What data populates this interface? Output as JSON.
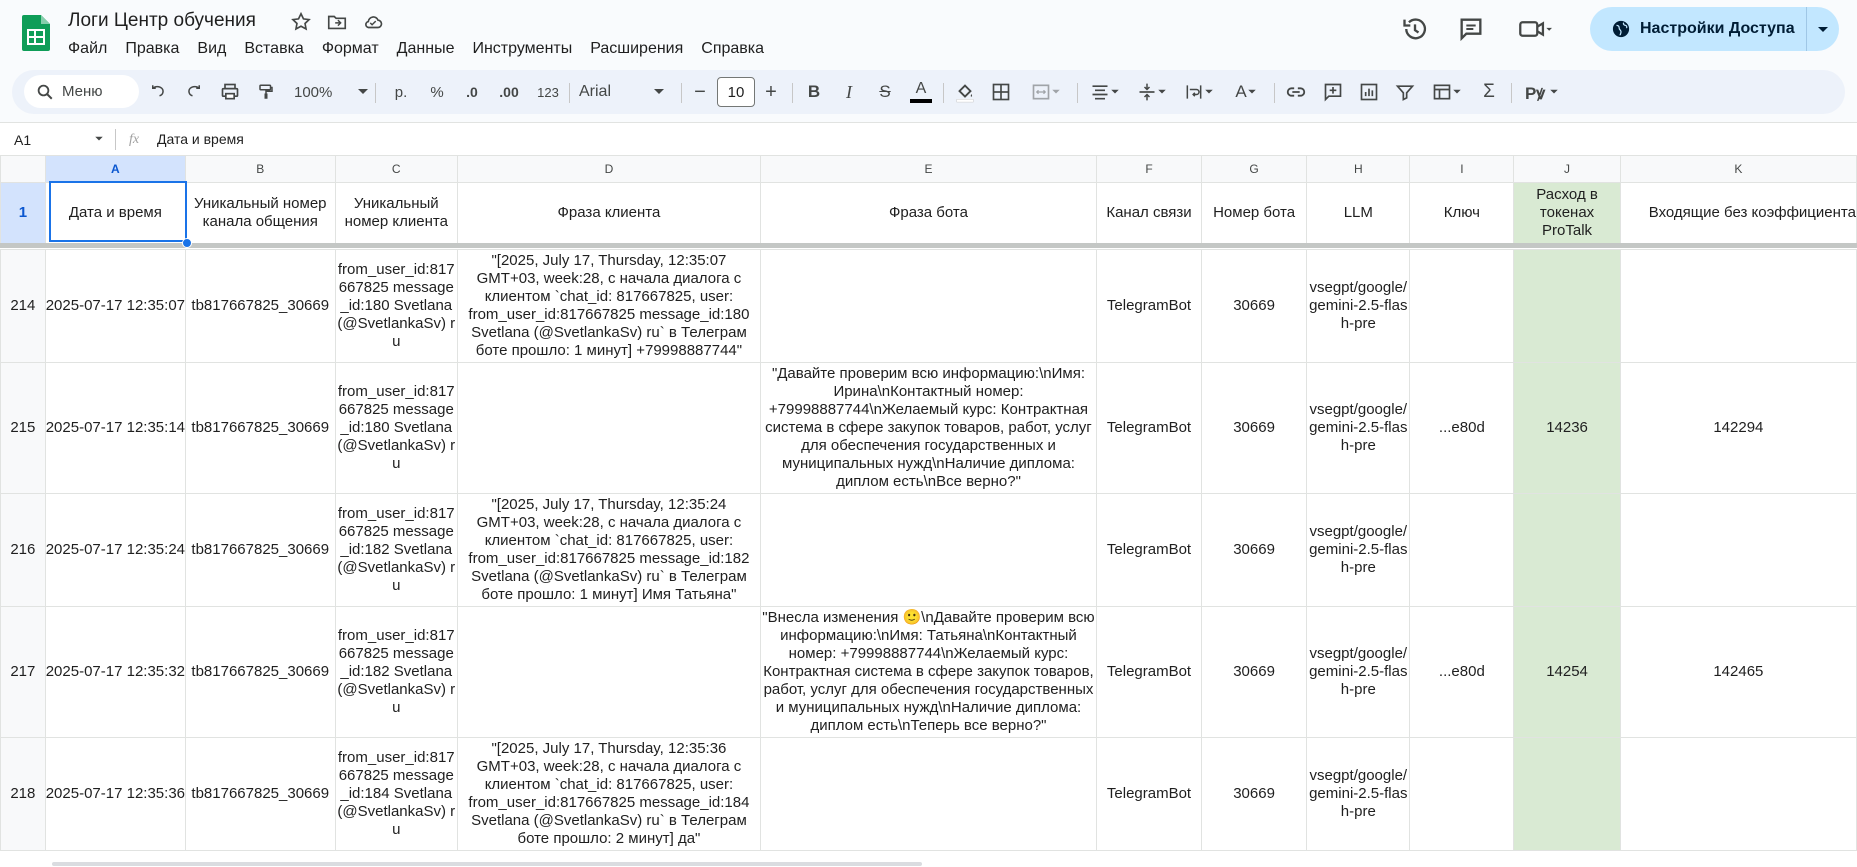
{
  "app": {
    "title": "Логи Центр обучения",
    "menu": [
      "Файл",
      "Правка",
      "Вид",
      "Вставка",
      "Формат",
      "Данные",
      "Инструменты",
      "Расширения",
      "Справка"
    ],
    "share_label": "Настройки Доступа"
  },
  "toolbar": {
    "search_label": "Меню",
    "zoom": "100%",
    "currency": "р.",
    "percent": "%",
    "decrease_decimal": ".0",
    "increase_decimal": ".00",
    "number_format": "123",
    "font": "Arial",
    "font_size": "10"
  },
  "formula_bar": {
    "cell_ref": "A1",
    "fx": "fx",
    "content": "Дата и время"
  },
  "sheet": {
    "columns": [
      "A",
      "B",
      "C",
      "D",
      "E",
      "F",
      "G",
      "H",
      "I",
      "J",
      "K"
    ],
    "header_row_number": "1",
    "headers": [
      "Дата и время",
      "Уникальный номер канала общения",
      "Уникальный номер клиента",
      "Фраза клиента",
      "Фраза бота",
      "Канал связи",
      "Номер бота",
      "LLM",
      "Ключ",
      "Расход в токенах ProTalk",
      "Входящие без коэффициента"
    ],
    "rows": [
      {
        "num": "214",
        "cells": [
          "2025-07-17 12:35:07",
          "tb817667825_30669",
          "from_user_id:817667825 message_id:180 Svetlana (@SvetlankaSv) ru",
          "\"[2025, July 17, Thursday, 12:35:07 GMT+03, week:28, с начала диалога с клиентом `chat_id: 817667825, user: from_user_id:817667825 message_id:180 Svetlana (@SvetlankaSv) ru` в Телеграм боте прошло: 1 минут] +79998887744\"",
          "",
          "TelegramBot",
          "30669",
          "vsegpt/google/gemini-2.5-flash-pre",
          "",
          "",
          ""
        ]
      },
      {
        "num": "215",
        "cells": [
          "2025-07-17 12:35:14",
          "tb817667825_30669",
          "from_user_id:817667825 message_id:180 Svetlana (@SvetlankaSv) ru",
          "",
          "\"Давайте проверим всю информацию:\\nИмя: Ирина\\nКонтактный номер: +79998887744\\nЖелаемый курс: Контрактная система в сфере закупок товаров, работ, услуг для обеспечения государственных и муниципальных нужд\\nНаличие диплома: диплом есть\\nВсе верно?\"",
          "TelegramBot",
          "30669",
          "vsegpt/google/gemini-2.5-flash-pre",
          "...e80d",
          "14236",
          "142294"
        ]
      },
      {
        "num": "216",
        "cells": [
          "2025-07-17 12:35:24",
          "tb817667825_30669",
          "from_user_id:817667825 message_id:182 Svetlana (@SvetlankaSv) ru",
          "\"[2025, July 17, Thursday, 12:35:24 GMT+03, week:28, с начала диалога с клиентом `chat_id: 817667825, user: from_user_id:817667825 message_id:182 Svetlana (@SvetlankaSv) ru` в Телеграм боте прошло: 1 минут] Имя Татьяна\"",
          "",
          "TelegramBot",
          "30669",
          "vsegpt/google/gemini-2.5-flash-pre",
          "",
          "",
          ""
        ]
      },
      {
        "num": "217",
        "cells": [
          "2025-07-17 12:35:32",
          "tb817667825_30669",
          "from_user_id:817667825 message_id:182 Svetlana (@SvetlankaSv) ru",
          "",
          "\"Внесла изменения 🙂\\nДавайте проверим всю информацию:\\nИмя: Татьяна\\nКонтактный номер: +79998887744\\nЖелаемый курс: Контрактная система в сфере закупок товаров, работ, услуг для обеспечения государственных и муниципальных нужд\\nНаличие диплома: диплом есть\\nТеперь все верно?\"",
          "TelegramBot",
          "30669",
          "vsegpt/google/gemini-2.5-flash-pre",
          "...e80d",
          "14254",
          "142465"
        ]
      },
      {
        "num": "218",
        "cells": [
          "2025-07-17 12:35:36",
          "tb817667825_30669",
          "from_user_id:817667825 message_id:184 Svetlana (@SvetlankaSv) ru",
          "\"[2025, July 17, Thursday, 12:35:36 GMT+03, week:28, с начала диалога с клиентом `chat_id: 817667825, user: from_user_id:817667825 message_id:184 Svetlana (@SvetlankaSv) ru` в Телеграм боте прошло: 2 минут] да\"",
          "",
          "TelegramBot",
          "30669",
          "vsegpt/google/gemini-2.5-flash-pre",
          "",
          "",
          ""
        ]
      }
    ]
  },
  "colors": {
    "accent": "#1a73e8",
    "share_bg": "#c2e7ff",
    "green_col": "#d9ead3",
    "sheets_green": "#0f9d58"
  }
}
